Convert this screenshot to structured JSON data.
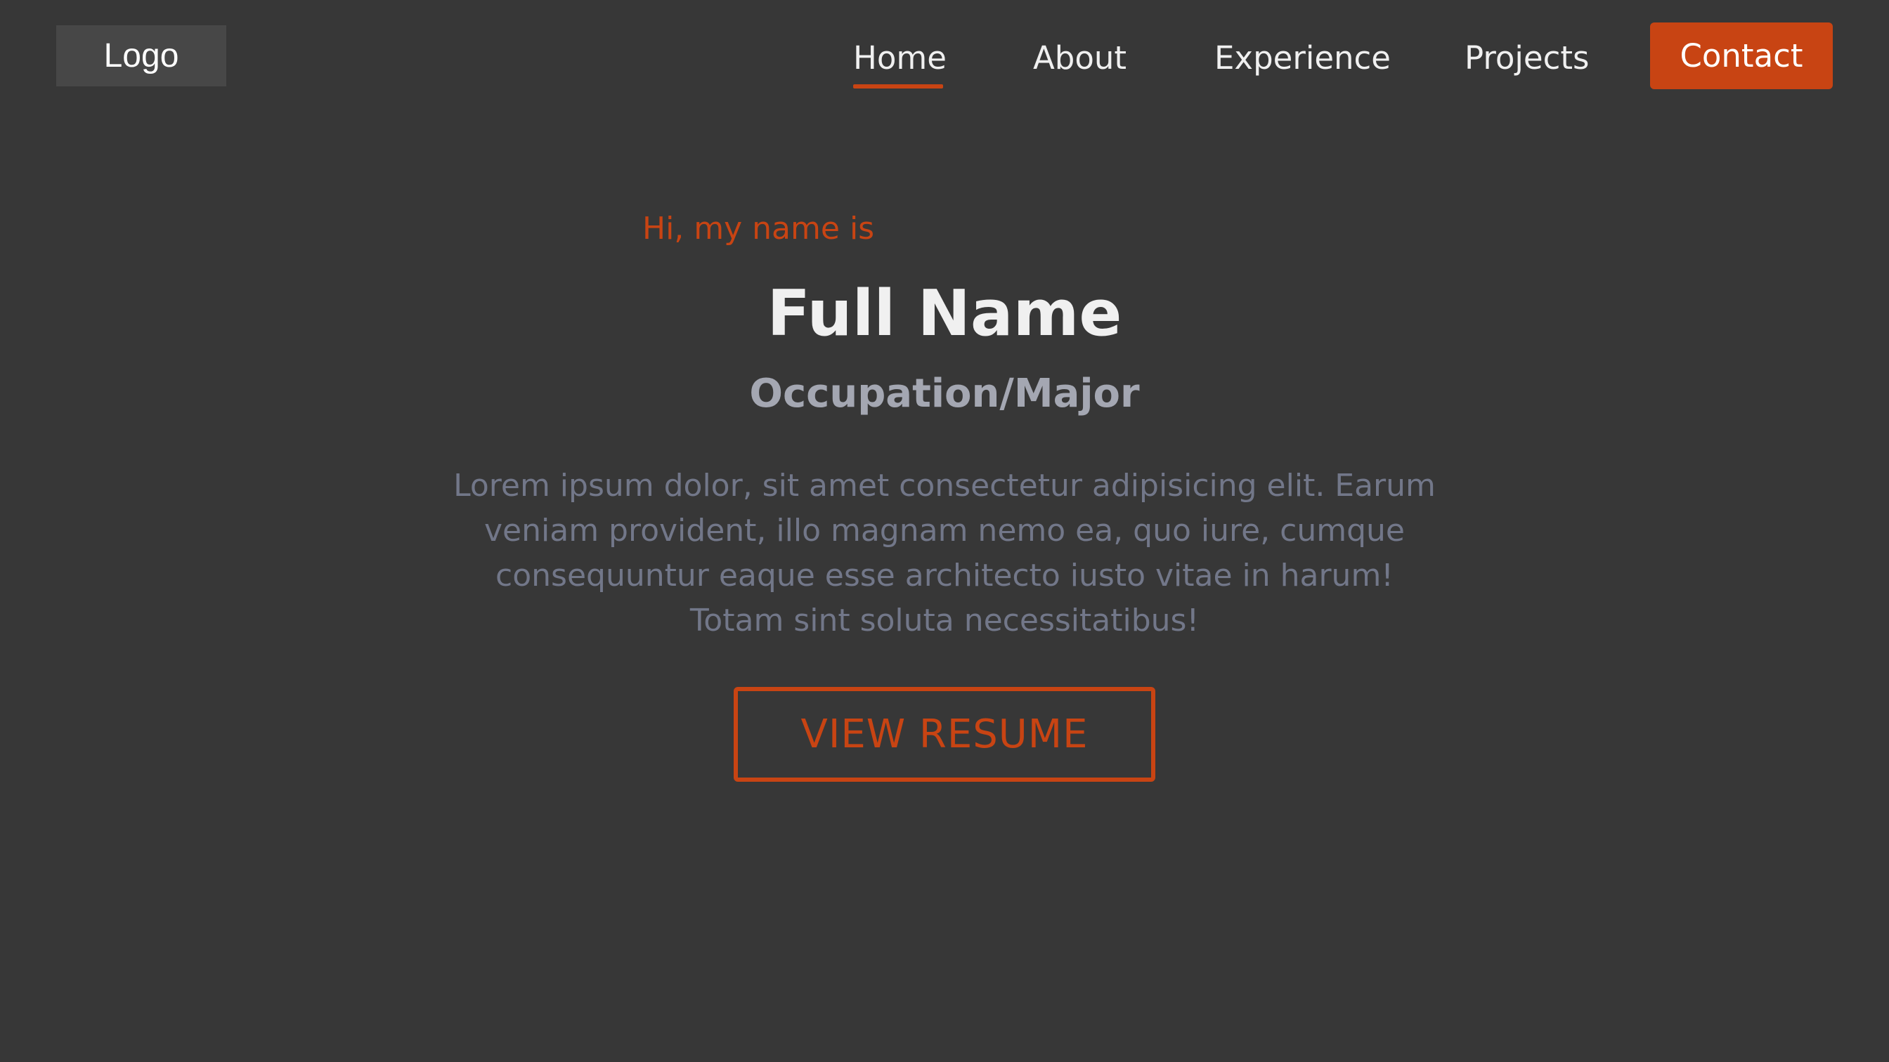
{
  "header": {
    "logo": "Logo",
    "nav": {
      "home": "Home",
      "about": "About",
      "experience": "Experience",
      "projects": "Projects",
      "contact": "Contact"
    },
    "active_item": "Home"
  },
  "hero": {
    "greeting": "Hi, my name is",
    "name": "Full Name",
    "occupation": "Occupation/Major",
    "bio": "Lorem ipsum dolor, sit amet consectetur adipisicing elit. Earum veniam provident, illo magnam nemo ea, quo iure, cumque consequuntur eaque esse architecto iusto vitae in harum! Totam sint soluta necessitatibus!",
    "resume_button": "VIEW RESUME"
  },
  "colors": {
    "background": "#373737",
    "accent": "#c84413",
    "logo_bg": "#474747",
    "heading": "#f0f0f0",
    "subheading": "#a4a7b2",
    "body_text": "#727789"
  }
}
